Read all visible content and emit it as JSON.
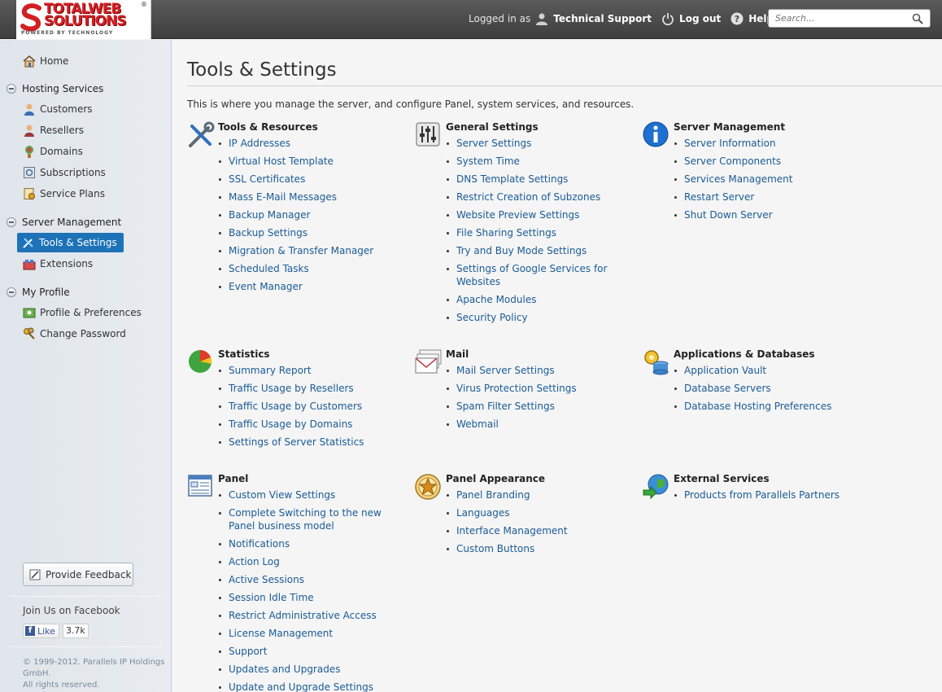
{
  "header": {
    "logo": {
      "line1": "TOTALWEB",
      "line2": "SOLUTIONS",
      "tagline": "POWERED BY TECHNOLOGY",
      "reg": "®"
    },
    "logged_in_as": "Logged in as",
    "user_name": "Technical Support",
    "logout_label": "Log out",
    "help_label": "Help",
    "search_placeholder": "Search..."
  },
  "sidebar": {
    "home": "Home",
    "groups": [
      {
        "title": "Hosting Services",
        "items": [
          "Customers",
          "Resellers",
          "Domains",
          "Subscriptions",
          "Service Plans"
        ]
      },
      {
        "title": "Server Management",
        "items": [
          "Tools & Settings",
          "Extensions"
        ]
      },
      {
        "title": "My Profile",
        "items": [
          "Profile & Preferences",
          "Change Password"
        ]
      }
    ],
    "active_item": "Tools & Settings",
    "feedback_label": "Provide Feedback",
    "facebook_title": "Join Us on Facebook",
    "like_label": "Like",
    "like_count": "3.7k",
    "copyright": [
      "© 1999-2012. Parallels IP Holdings",
      "GmbH.",
      "All rights reserved."
    ]
  },
  "main": {
    "title": "Tools & Settings",
    "intro": "This is where you manage the server, and configure Panel, system services, and resources.",
    "sections": [
      {
        "title": "Tools & Resources",
        "icon": "tools-icon",
        "links": [
          "IP Addresses",
          "Virtual Host Template",
          "SSL Certificates",
          "Mass E-Mail Messages",
          "Backup Manager",
          "Backup Settings",
          "Migration & Transfer Manager",
          "Scheduled Tasks",
          "Event Manager"
        ]
      },
      {
        "title": "General Settings",
        "icon": "sliders-icon",
        "links": [
          "Server Settings",
          "System Time",
          "DNS Template Settings",
          "Restrict Creation of Subzones",
          "Website Preview Settings",
          "File Sharing Settings",
          "Try and Buy Mode Settings",
          "Settings of Google Services for Websites",
          "Apache Modules",
          "Security Policy"
        ]
      },
      {
        "title": "Server Management",
        "icon": "info-icon",
        "links": [
          "Server Information",
          "Server Components",
          "Services Management",
          "Restart Server",
          "Shut Down Server"
        ]
      },
      {
        "title": "Statistics",
        "icon": "pie-chart-icon",
        "links": [
          "Summary Report",
          "Traffic Usage by Resellers",
          "Traffic Usage by Customers",
          "Traffic Usage by Domains",
          "Settings of Server Statistics"
        ]
      },
      {
        "title": "Mail",
        "icon": "mail-icon",
        "links": [
          "Mail Server Settings",
          "Virus Protection Settings",
          "Spam Filter Settings",
          "Webmail"
        ]
      },
      {
        "title": "Applications & Databases",
        "icon": "apps-db-icon",
        "links": [
          "Application Vault",
          "Database Servers",
          "Database Hosting Preferences"
        ]
      },
      {
        "title": "Panel",
        "icon": "panel-icon",
        "links": [
          "Custom View Settings",
          "Complete Switching to the new Panel business model",
          "Notifications",
          "Action Log",
          "Active Sessions",
          "Session Idle Time",
          "Restrict Administrative Access",
          "License Management",
          "Support",
          "Updates and Upgrades",
          "Update and Upgrade Settings"
        ]
      },
      {
        "title": "Panel Appearance",
        "icon": "star-badge-icon",
        "links": [
          "Panel Branding",
          "Languages",
          "Interface Management",
          "Custom Buttons"
        ]
      },
      {
        "title": "External Services",
        "icon": "globe-icon",
        "links": [
          "Products from Parallels Partners"
        ]
      }
    ]
  },
  "colors": {
    "link": "#1a5b96",
    "active_nav": "#1d72b8",
    "header_bg": "#4a4a4a"
  }
}
